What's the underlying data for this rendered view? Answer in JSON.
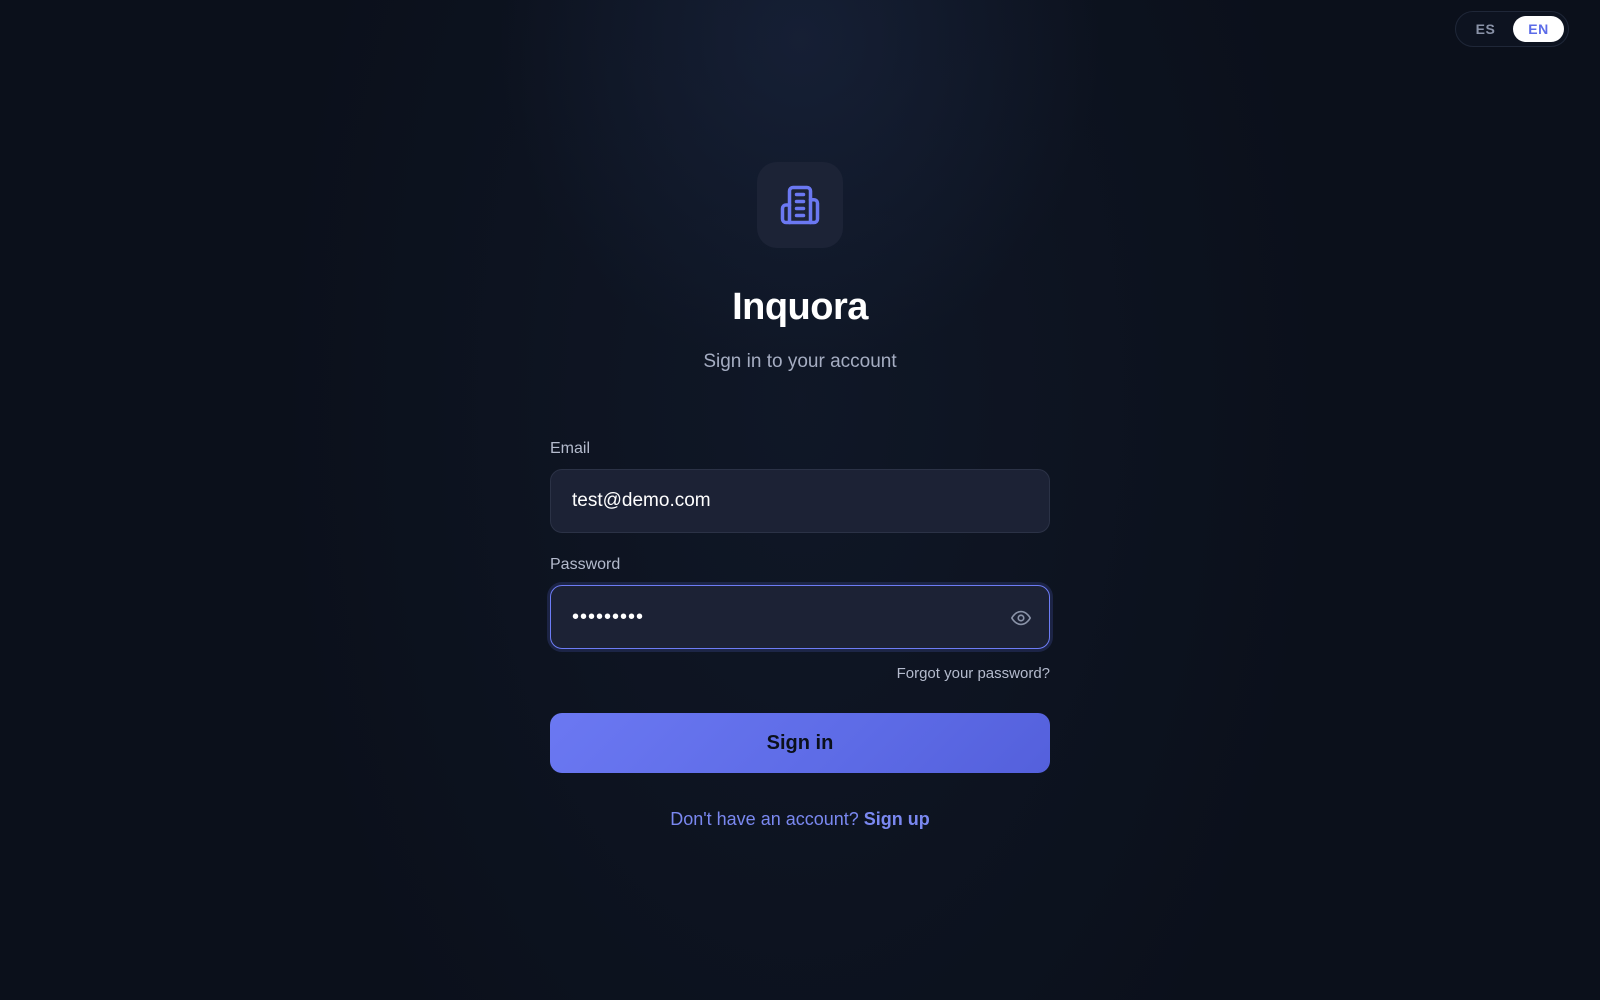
{
  "language_switch": {
    "options": [
      "ES",
      "EN"
    ],
    "selected": "EN"
  },
  "brand": {
    "logo_icon": "building-icon",
    "name": "Inquora",
    "tagline": "Sign in to your account"
  },
  "form": {
    "email_label": "Email",
    "email_value": "test@demo.com",
    "password_label": "Password",
    "password_value": "•••••••••",
    "password_toggle_icon": "eye-icon",
    "forgot_link": "Forgot your password?",
    "submit_label": "Sign in",
    "signup_prompt": "Don't have an account?",
    "signup_link": "Sign up"
  },
  "colors": {
    "background": "#0b101b",
    "accent": "#6b78f2",
    "input_bg": "#1c2235"
  }
}
